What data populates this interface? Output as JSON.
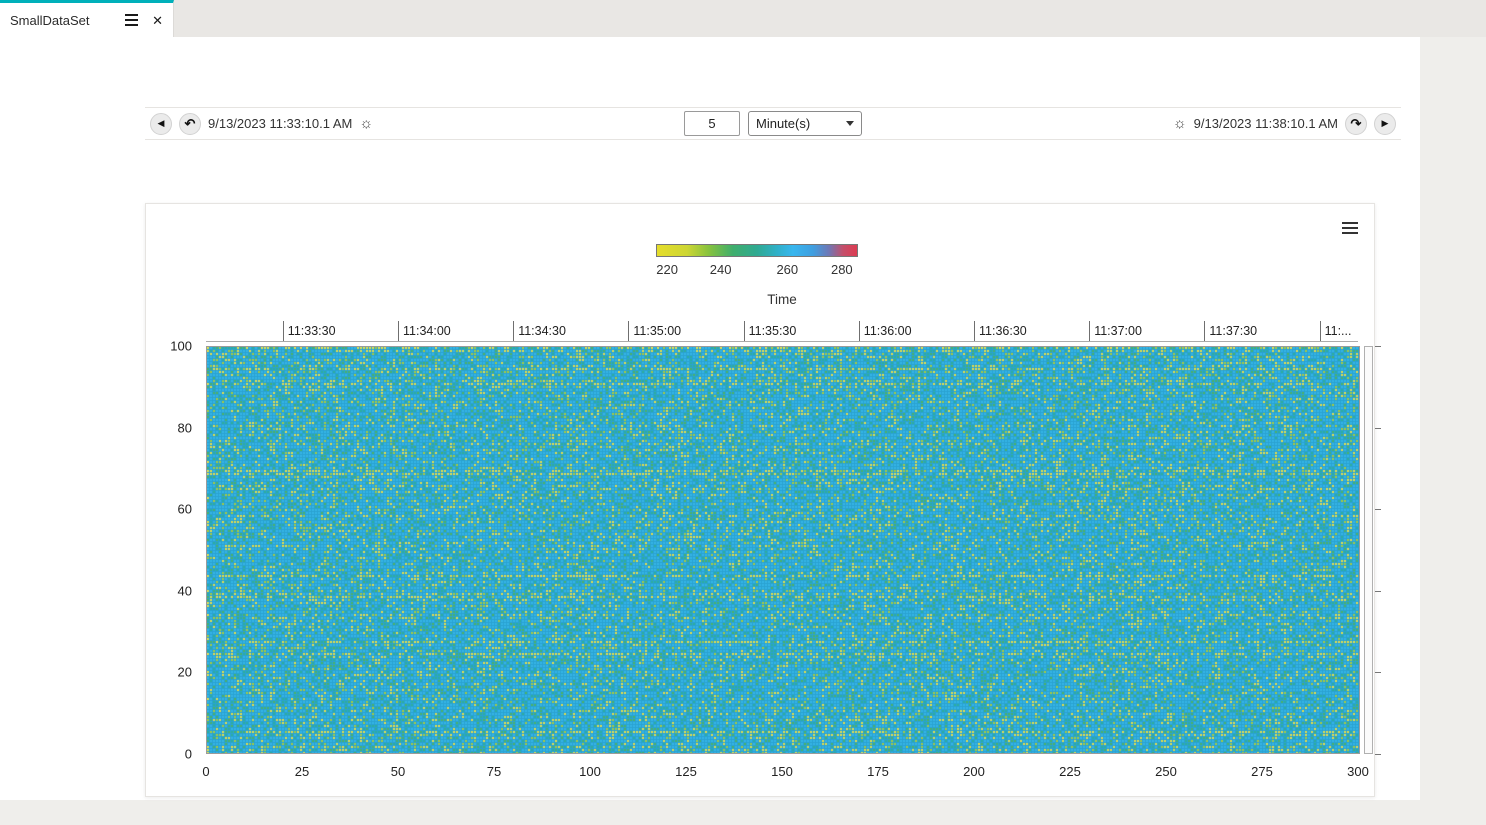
{
  "tab": {
    "title": "SmallDataSet"
  },
  "icons": {
    "close": "✕",
    "prev": "◀",
    "next": "▶",
    "shift_back": "↶",
    "shift_forward": "↷",
    "sun": "☼"
  },
  "toolbar": {
    "start_time": "9/13/2023 11:33:10.1 AM",
    "end_time": "9/13/2023 11:38:10.1 AM",
    "interval_value": "5",
    "interval_unit": "Minute(s)"
  },
  "chart_data": {
    "type": "heatmap",
    "time_axis_label": "Time",
    "top_axis_ticks": [
      "11:33:30",
      "11:34:00",
      "11:34:30",
      "11:35:00",
      "11:35:30",
      "11:36:00",
      "11:36:30",
      "11:37:00",
      "11:37:30",
      "11:..."
    ],
    "left_axis_ticks": [
      "100",
      "80",
      "60",
      "40",
      "20",
      "0"
    ],
    "bottom_axis_ticks": [
      "0",
      "25",
      "50",
      "75",
      "100",
      "125",
      "150",
      "175",
      "200",
      "225",
      "250",
      "275",
      "300"
    ],
    "x_range": [
      0,
      300
    ],
    "y_range": [
      0,
      100
    ],
    "legend": {
      "ticks": [
        "220",
        "240",
        "260",
        "280"
      ],
      "tick_positions_pct": [
        5.5,
        32,
        65,
        92
      ],
      "gradient_stops": [
        "#e5dd2b 0%",
        "#cdd633 15%",
        "#86c23e 26%",
        "#3fae6d 38%",
        "#2faa92 50%",
        "#2fb0c8 60%",
        "#38b6ee 68%",
        "#3f9ee0 78%",
        "#6f77b5 86%",
        "#c44f6a 93%",
        "#dd3b51 100%"
      ]
    },
    "heatmap_colors": {
      "base": "#2aa2d2",
      "cyan": "#35b4e6",
      "teal": "#2fae9d",
      "green": "#4db368",
      "lime": "#a8cc3f",
      "yellow": "#e6e04b"
    }
  }
}
